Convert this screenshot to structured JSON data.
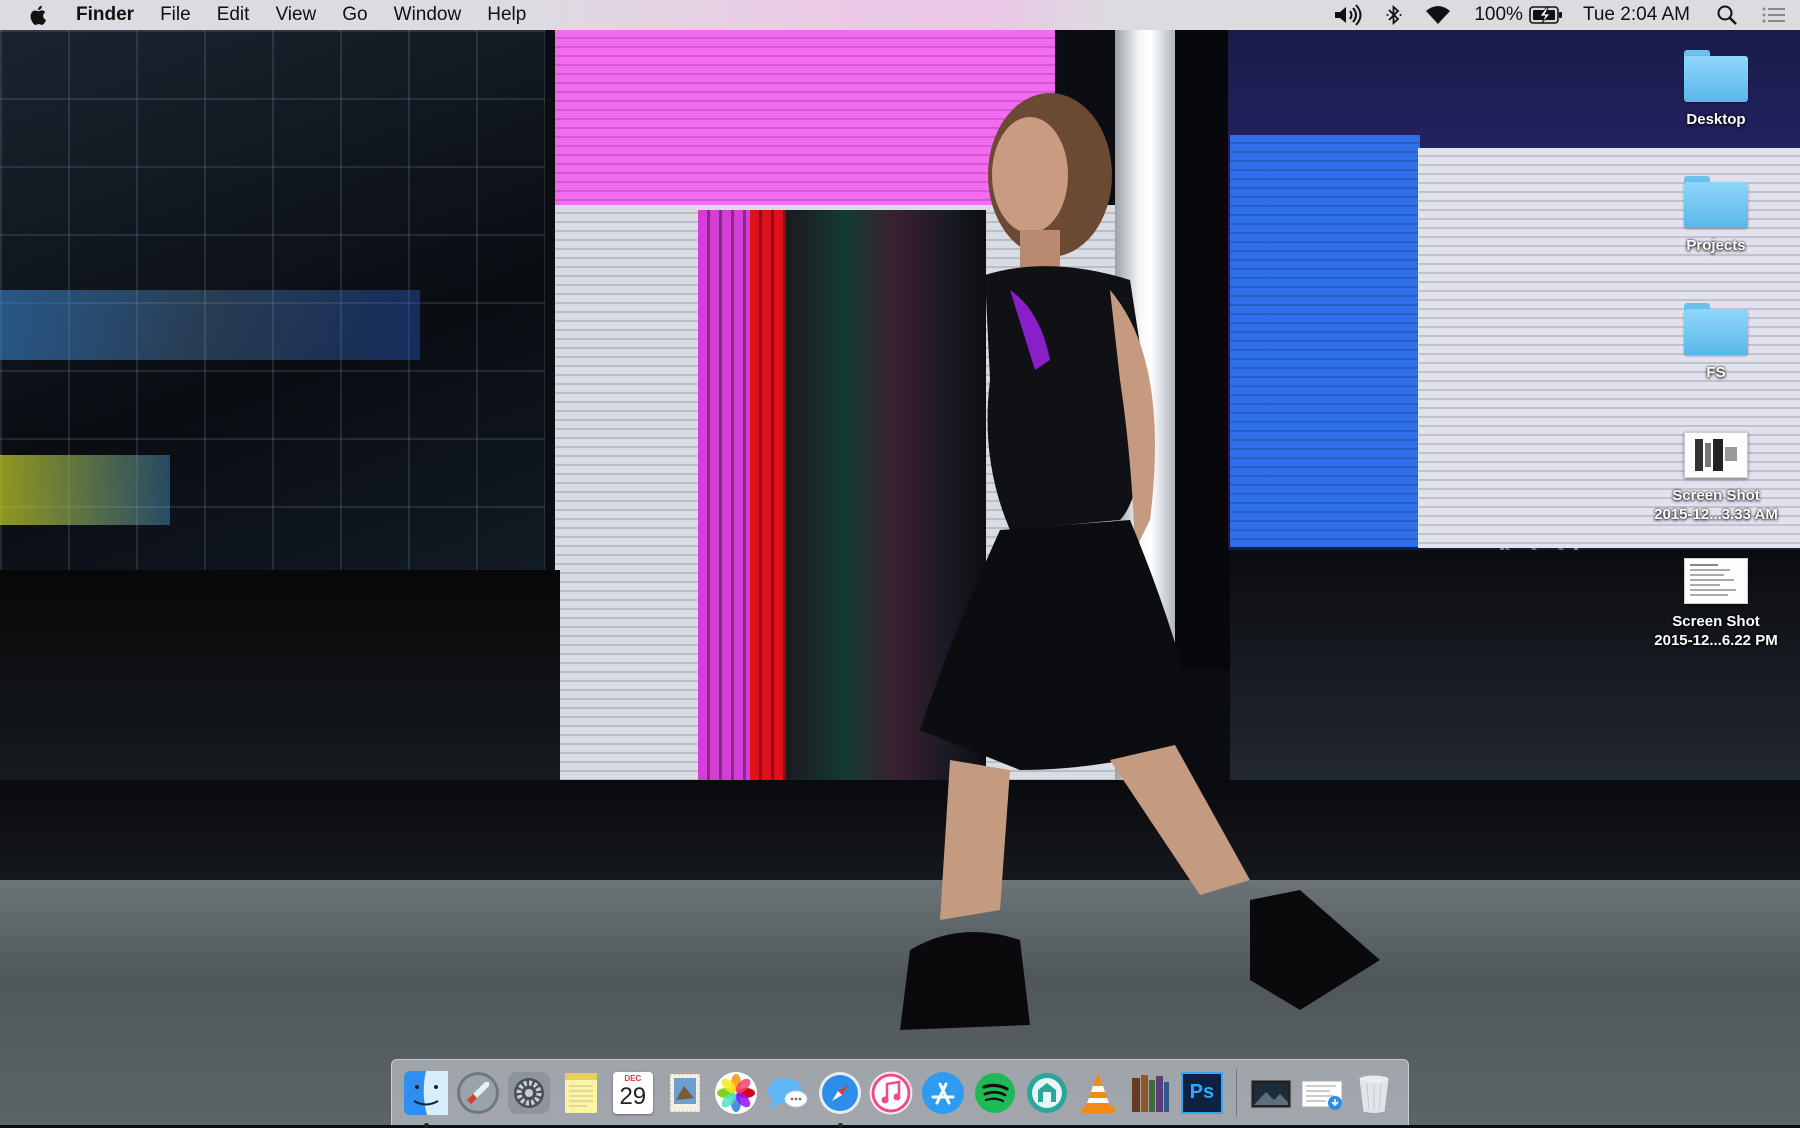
{
  "menubar": {
    "apple_icon": "apple-logo-icon",
    "app_name": "Finder",
    "menus": [
      "File",
      "Edit",
      "View",
      "Go",
      "Window",
      "Help"
    ],
    "status": {
      "volume_icon": "speaker-icon",
      "bluetooth_icon": "bluetooth-icon",
      "wifi_icon": "wifi-icon",
      "battery_percent": "100%",
      "battery_icon": "battery-charging-icon",
      "clock": "Tue 2:04 AM",
      "spotlight_icon": "magnifier-icon",
      "notification_icon": "list-icon"
    }
  },
  "desktop": {
    "items": [
      {
        "label": "Desktop",
        "kind": "folder"
      },
      {
        "label": "Projects",
        "kind": "folder"
      },
      {
        "label": "FS",
        "kind": "folder"
      },
      {
        "label_line1": "Screen Shot",
        "label_line2": "2015-12...3.33 AM",
        "kind": "screenshot"
      },
      {
        "label_line1": "Screen Shot",
        "label_line2": "2015-12...6.22 PM",
        "kind": "screenshot"
      }
    ]
  },
  "dock": {
    "apps": [
      {
        "name": "finder-icon",
        "running": true
      },
      {
        "name": "launchpad-rocket-icon",
        "running": false
      },
      {
        "name": "system-preferences-gear-icon",
        "running": false
      },
      {
        "name": "notes-icon",
        "running": false
      },
      {
        "name": "calendar-icon",
        "running": false,
        "month": "DEC",
        "day": "29"
      },
      {
        "name": "mail-stamp-icon",
        "running": false
      },
      {
        "name": "photos-icon",
        "running": false
      },
      {
        "name": "messages-bubble-icon",
        "running": false
      },
      {
        "name": "safari-compass-icon",
        "running": true
      },
      {
        "name": "itunes-note-icon",
        "running": false
      },
      {
        "name": "app-store-icon",
        "running": false
      },
      {
        "name": "spotify-icon",
        "running": false
      },
      {
        "name": "stuffit-icon",
        "running": false
      },
      {
        "name": "vlc-cone-icon",
        "running": false
      },
      {
        "name": "ibooks-books-icon",
        "running": false
      },
      {
        "name": "photoshop-icon",
        "running": false,
        "text": "Ps"
      }
    ],
    "stacks": [
      {
        "name": "photo-stack-icon"
      },
      {
        "name": "downloads-stack-icon"
      },
      {
        "name": "trash-icon"
      }
    ]
  },
  "colors": {
    "folder_blue": "#6cc2ee",
    "menubar_bg": "#ececf0",
    "magenta_screen": "#f06af0",
    "blue_screen": "#2d6ee8"
  }
}
